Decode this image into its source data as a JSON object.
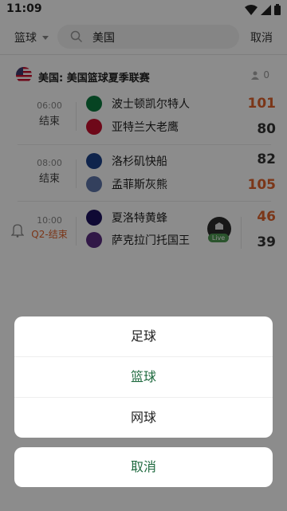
{
  "status_bar": {
    "time": "11:09"
  },
  "header": {
    "sport_label": "篮球",
    "search_value": "美国",
    "cancel_label": "取消"
  },
  "league": {
    "name": "美国: 美国篮球夏季联赛",
    "follow_count": "0"
  },
  "matches": [
    {
      "time": "06:00",
      "status": "结束",
      "home": {
        "name": "波士顿凯尔特人",
        "score": "101",
        "logo_color": "#0b7a3e"
      },
      "away": {
        "name": "亚特兰大老鹰",
        "score": "80",
        "logo_color": "#c8102e"
      },
      "winner": "home"
    },
    {
      "time": "08:00",
      "status": "结束",
      "home": {
        "name": "洛杉矶快船",
        "score": "82",
        "logo_color": "#1d428a"
      },
      "away": {
        "name": "孟菲斯灰熊",
        "score": "105",
        "logo_color": "#5d76a9"
      },
      "winner": "away"
    },
    {
      "time": "10:00",
      "status": "Q2-结束",
      "home": {
        "name": "夏洛特黄蜂",
        "score": "46",
        "logo_color": "#1d1160"
      },
      "away": {
        "name": "萨克拉门托国王",
        "score": "39",
        "logo_color": "#5a2d81"
      },
      "winner": "home",
      "live_label": "Live"
    }
  ],
  "action_sheet": {
    "options": [
      "足球",
      "篮球",
      "网球"
    ],
    "selected": "篮球",
    "cancel_label": "取消"
  },
  "colors": {
    "accent": "#1f6a3f",
    "score_win": "#e0632c",
    "live_green": "#4f9a52"
  }
}
